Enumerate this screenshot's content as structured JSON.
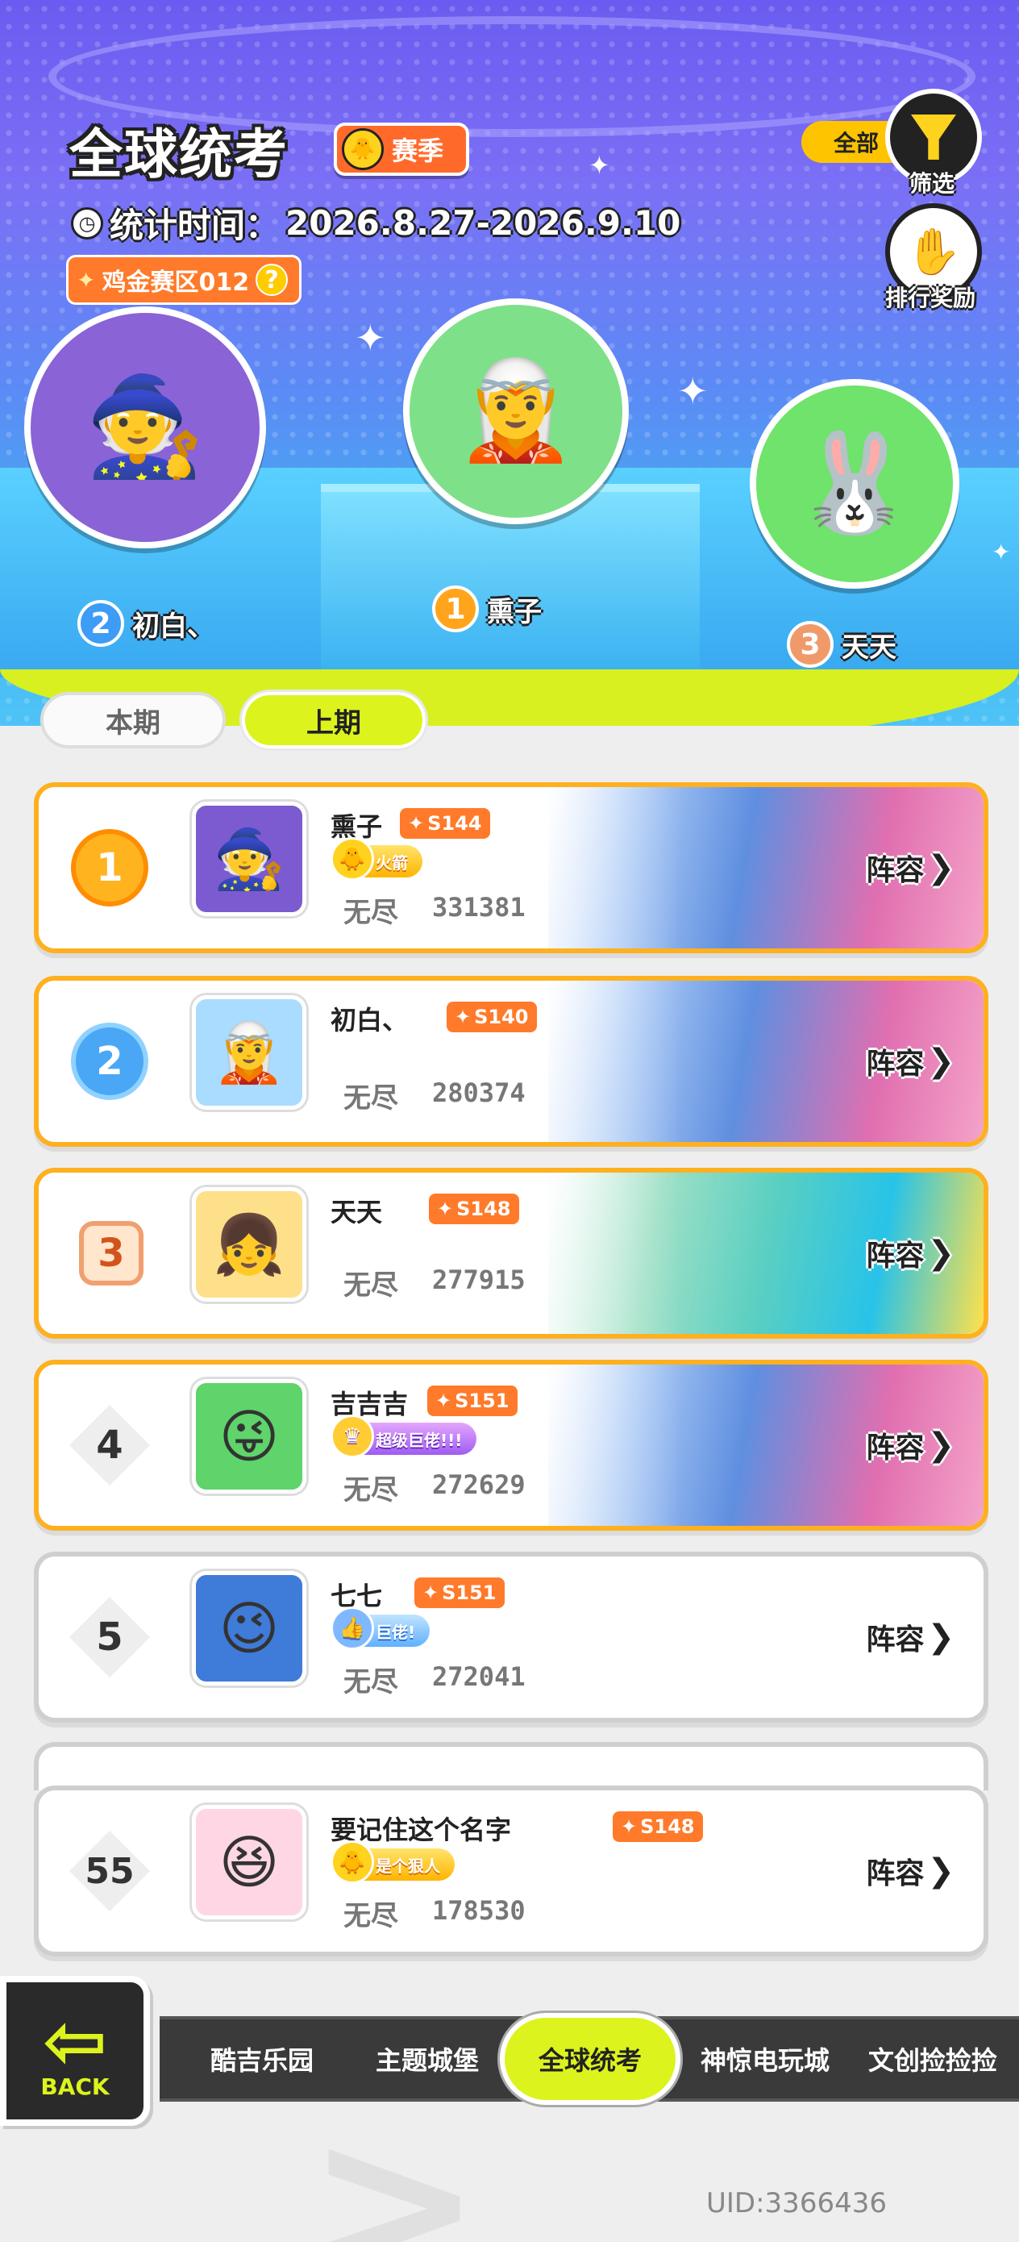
{
  "header": {
    "title": "全球统考",
    "season_label": "赛季",
    "stat_time_label": "统计时间：",
    "stat_time_value": "2026.8.27-2026.9.10",
    "zone_label": "鸡金赛区012",
    "zone_help": "?",
    "filter_value": "全部",
    "filter_label": "筛选",
    "reward_label": "排行奖励"
  },
  "podium": [
    {
      "rank": "2",
      "name": "初白、",
      "rank_color": "#3d9cf5"
    },
    {
      "rank": "1",
      "name": "熏子",
      "rank_color": "#ffa41b"
    },
    {
      "rank": "3",
      "name": "天天",
      "rank_color": "#f09a6a"
    }
  ],
  "tabs": [
    {
      "label": "本期",
      "active": false
    },
    {
      "label": "上期",
      "active": true
    }
  ],
  "rows": [
    {
      "rank": "1",
      "name": "熏子",
      "season": "S144",
      "title": "火箭",
      "mode": "无尽",
      "score": "331381",
      "lineup": "阵容"
    },
    {
      "rank": "2",
      "name": "初白、",
      "season": "S140",
      "title": "",
      "mode": "无尽",
      "score": "280374",
      "lineup": "阵容"
    },
    {
      "rank": "3",
      "name": "天天",
      "season": "S148",
      "title": "",
      "mode": "无尽",
      "score": "277915",
      "lineup": "阵容"
    },
    {
      "rank": "4",
      "name": "吉吉吉",
      "season": "S151",
      "title": "超级巨佬!!!",
      "mode": "无尽",
      "score": "272629",
      "lineup": "阵容"
    },
    {
      "rank": "5",
      "name": "七七",
      "season": "S151",
      "title": "巨佬!",
      "mode": "无尽",
      "score": "272041",
      "lineup": "阵容"
    }
  ],
  "self_row": {
    "rank": "55",
    "name": "要记住这个名字",
    "season": "S148",
    "title": "是个狠人",
    "mode": "无尽",
    "score": "178530",
    "lineup": "阵容"
  },
  "nav": {
    "back_label": "BACK",
    "items": [
      "酷吉乐园",
      "主题城堡",
      "全球统考",
      "神惊电玩城",
      "文创捡捡捡"
    ],
    "active_index": 2
  },
  "footer": {
    "uid": "UID:3366436"
  },
  "colors": {
    "accent": "#dcf31e",
    "gold": "#ffb01f",
    "badge": "#ff7a2a"
  }
}
